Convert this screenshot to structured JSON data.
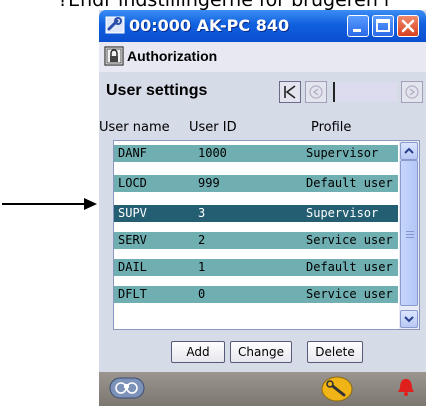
{
  "caption": "?Endr indstillingerne for brugeren i",
  "window": {
    "title": "00:000 AK-PC 840",
    "authorization_label": "Authorization",
    "section_title": "User settings"
  },
  "columns": {
    "name": "User name",
    "id": "User ID",
    "profile": "Profile"
  },
  "users": [
    {
      "name": "DANF",
      "id": "1000",
      "profile": "Supervisor"
    },
    {
      "name": "LOCD",
      "id": "999",
      "profile": "Default user"
    },
    {
      "name": "SUPV",
      "id": "3",
      "profile": "Supervisor"
    },
    {
      "name": "SERV",
      "id": "2",
      "profile": "Service user"
    },
    {
      "name": "DAIL",
      "id": "1",
      "profile": "Default user"
    },
    {
      "name": "DFLT",
      "id": "0",
      "profile": "Service user"
    }
  ],
  "selected_row": 2,
  "buttons": {
    "add": "Add",
    "change": "Change",
    "delete": "Delete"
  },
  "colors": {
    "title_bar": "#1060e0",
    "row": "#6faeb1",
    "row_selected": "#235e73",
    "close_button": "#d5411f"
  },
  "icons": {
    "app": "wrench-icon",
    "authorization": "lock-icon",
    "footer_left": "binoculars-icon",
    "footer_middle": "wrench-icon",
    "footer_right": "bell-icon"
  }
}
